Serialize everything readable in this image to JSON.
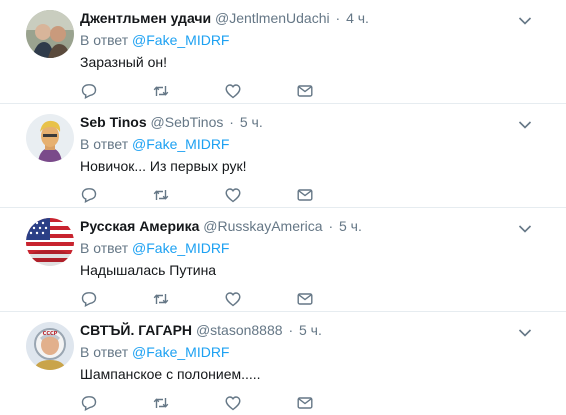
{
  "tweets": [
    {
      "name": "Джентльмен удачи",
      "handle": "@JentlmenUdachi",
      "separator": "·",
      "time": "4 ч.",
      "reply_prefix": "В ответ",
      "reply_to": "@Fake_MIDRF",
      "text": "Заразный он!",
      "avatar_icon": "avatar-photo"
    },
    {
      "name": "Seb Tinos",
      "handle": "@SebTinos",
      "separator": "·",
      "time": "5 ч.",
      "reply_prefix": "В ответ",
      "reply_to": "@Fake_MIDRF",
      "text": "Новичок... Из первых рук!",
      "avatar_icon": "avatar-cartoon"
    },
    {
      "name": "Русская Америка",
      "handle": "@RusskayAmerica",
      "separator": "·",
      "time": "5 ч.",
      "reply_prefix": "В ответ",
      "reply_to": "@Fake_MIDRF",
      "text": "Надышалась Путина",
      "avatar_icon": "us-flag-avatar"
    },
    {
      "name": "СВТЪЙ. ГАГАРН",
      "handle": "@stason8888",
      "separator": "·",
      "time": "5 ч.",
      "reply_prefix": "В ответ",
      "reply_to": "@Fake_MIDRF",
      "text": "Шампанское с полонием.....",
      "avatar_icon": "astronaut-avatar"
    }
  ],
  "icons": {
    "reply": "reply-icon",
    "retweet": "retweet-icon",
    "like": "heart-icon",
    "dm": "envelope-icon",
    "more": "chevron-down-icon"
  },
  "colors": {
    "link": "#1da1f2",
    "muted": "#657786",
    "text": "#14171a",
    "divider": "#e6ecf0"
  }
}
